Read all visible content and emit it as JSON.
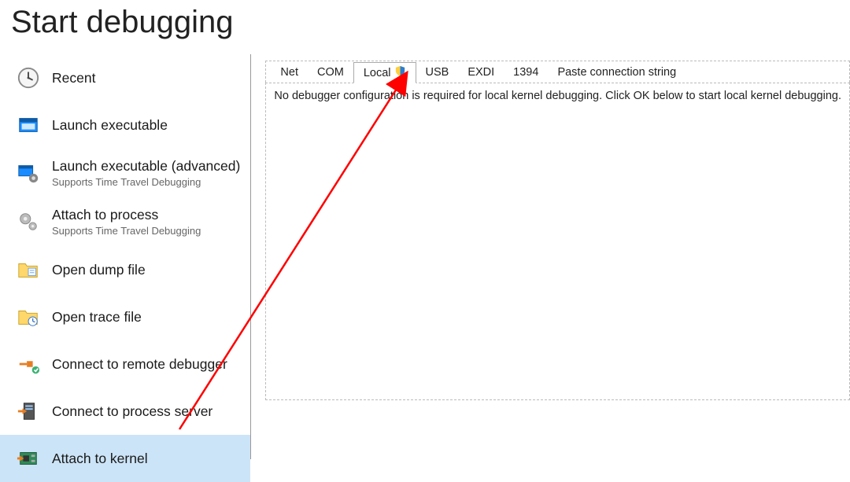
{
  "title": "Start debugging",
  "sidebar": {
    "items": [
      {
        "label": "Recent",
        "sub": ""
      },
      {
        "label": "Launch executable",
        "sub": ""
      },
      {
        "label": "Launch executable (advanced)",
        "sub": "Supports Time Travel Debugging"
      },
      {
        "label": "Attach to process",
        "sub": "Supports Time Travel Debugging"
      },
      {
        "label": "Open dump file",
        "sub": ""
      },
      {
        "label": "Open trace file",
        "sub": ""
      },
      {
        "label": "Connect to remote debugger",
        "sub": ""
      },
      {
        "label": "Connect to process server",
        "sub": ""
      },
      {
        "label": "Attach to kernel",
        "sub": ""
      }
    ],
    "selected_index": 8
  },
  "tabs": [
    {
      "label": "Net"
    },
    {
      "label": "COM"
    },
    {
      "label": "Local"
    },
    {
      "label": "USB"
    },
    {
      "label": "EXDI"
    },
    {
      "label": "1394"
    },
    {
      "label": "Paste connection string"
    }
  ],
  "tabs_selected_index": 2,
  "content_text": "No debugger configuration is required for local kernel debugging. Click OK below to start local kernel debugging.",
  "annotation": {
    "from_target": "Attach to kernel",
    "to_target": "Local tab"
  }
}
